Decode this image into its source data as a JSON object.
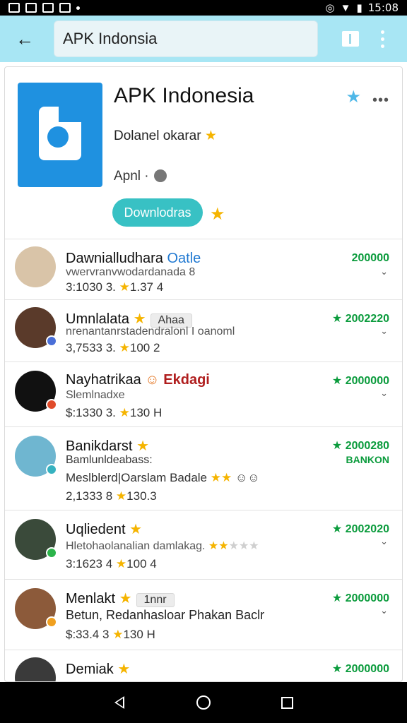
{
  "status": {
    "time": "15:08"
  },
  "search": {
    "value": "APK Indonsia"
  },
  "app": {
    "title": "APK Indonesia",
    "subtitle": "Dolanel okarar",
    "meta": "Apnl ·",
    "download_label": "Downlodras"
  },
  "rows": [
    {
      "name": "Dawnialludhara",
      "name_extra": "Oatle",
      "line2": "vwervranvwodardanada 8",
      "stats": "3:1030 3.",
      "rating": "1.37 4",
      "downloads": "200000"
    },
    {
      "name": "Umnlalata",
      "tag": "Ahaa",
      "line2": "nrenantanrstadendralonl I oanoml",
      "stats": "3,7533 3.",
      "rating": "100 2",
      "downloads": "2002220"
    },
    {
      "name": "Nayhatrikaa",
      "name_extra": "Ekdagi",
      "line2": "Slemlnadxe",
      "stats": "$:1330 3.",
      "rating": "130 H",
      "downloads": "2000000"
    },
    {
      "name": "Banikdarst",
      "line2": "Bamlunldeabass:",
      "line3": "Meslblerd|Oarslam Badale",
      "stats": "2,1333 8",
      "rating": "130.3",
      "downloads": "2000280",
      "downloads_sub": "BANKON"
    },
    {
      "name": "Uqliedent",
      "line2": "Hletohaolanalian damlakag.",
      "stats": "3:1623 4",
      "rating": "100 4",
      "downloads": "2002020"
    },
    {
      "name": "Menlakt",
      "tag": "1nnr",
      "line2": "Betun, Redanhasloar Phakan Baclr",
      "stats": "$:33.4 3",
      "rating": "130 H",
      "downloads": "2000000"
    },
    {
      "name": "Demiak",
      "downloads": "2000000"
    }
  ],
  "colors": {
    "accent": "#38c1c4",
    "app_bar": "#a8e6f4",
    "star": "#f5b400",
    "download_green": "#0a9b3c",
    "app_icon": "#1f91e0"
  }
}
